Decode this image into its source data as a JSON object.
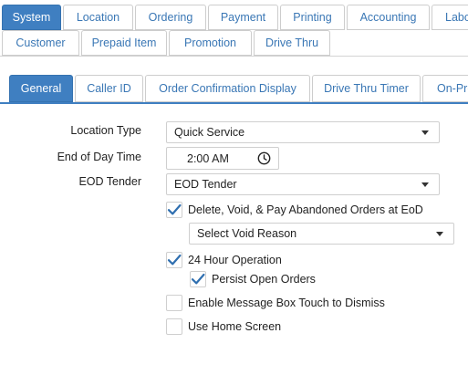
{
  "top_tabs_row1": [
    "System",
    "Location",
    "Ordering",
    "Payment",
    "Printing",
    "Accounting",
    "Labor"
  ],
  "top_tabs_row2": [
    "Customer",
    "Prepaid Item",
    "Promotion",
    "Drive Thru"
  ],
  "sub_tabs": [
    "General",
    "Caller ID",
    "Order Confirmation Display",
    "Drive Thru Timer",
    "On-Premise"
  ],
  "form": {
    "location_type": {
      "label": "Location Type",
      "value": "Quick Service"
    },
    "end_of_day_time": {
      "label": "End of Day Time",
      "value": "2:00 AM"
    },
    "eod_tender": {
      "label": "EOD Tender",
      "value": "EOD Tender"
    },
    "void_reason": {
      "value": "Select Void Reason"
    }
  },
  "checkboxes": {
    "delete_void_pay": {
      "label": "Delete, Void, & Pay Abandoned Orders at EoD",
      "checked": true
    },
    "hour24": {
      "label": "24 Hour Operation",
      "checked": true
    },
    "persist_open_orders": {
      "label": "Persist Open Orders",
      "checked": true
    },
    "message_box_touch": {
      "label": "Enable Message Box Touch to Dismiss",
      "checked": false
    },
    "home_screen": {
      "label": "Use Home Screen",
      "checked": false
    }
  },
  "colors": {
    "accent": "#3f7fc1",
    "link": "#3a77b5",
    "check": "#2f6fb0"
  }
}
